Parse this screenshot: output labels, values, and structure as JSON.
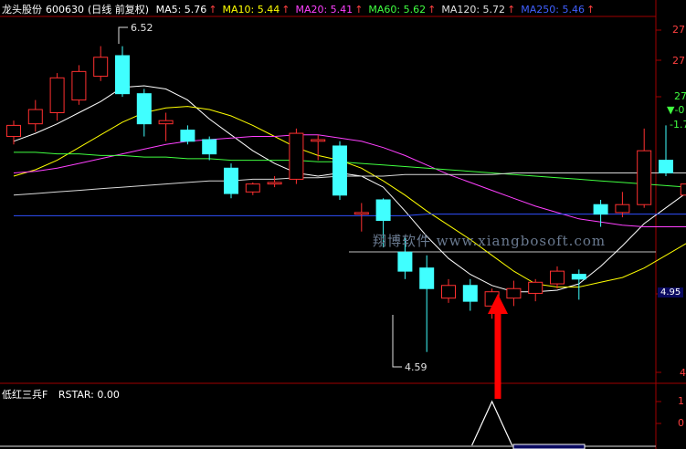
{
  "header": {
    "stock_name": "龙头股份",
    "stock_code": "600630",
    "period": "(日线 前复权)",
    "ma": [
      {
        "label": "MA5: 5.76",
        "color": "#ffffff"
      },
      {
        "label": "MA10: 5.44",
        "color": "#ffff00"
      },
      {
        "label": "MA20: 5.41",
        "color": "#ff40ff"
      },
      {
        "label": "MA60: 5.62",
        "color": "#40ff40"
      },
      {
        "label": "MA120: 5.72",
        "color": "#e0e0e0"
      },
      {
        "label": "MA250: 5.46",
        "color": "#4060ff"
      }
    ],
    "up_arrow": "↑"
  },
  "annotations": {
    "high_label": "6.52",
    "low_label": "4.59"
  },
  "right_axis": {
    "labels": [
      "27",
      "27",
      "27",
      "4.95",
      "4"
    ],
    "marker_down": "▼-0",
    "value_neg": "-1.7"
  },
  "indicator": {
    "name": "低红三兵F",
    "value": "RSTAR: 0.00",
    "axis_labels": [
      "1",
      "0"
    ]
  },
  "watermark": "翔博软件 www.xiangbosoft.com",
  "colors": {
    "background": "#000000",
    "up_candle": "#ff3030",
    "down_candle": "#40ffff",
    "arrow": "#ff0000",
    "axis": "#a00000"
  },
  "chart_data": {
    "type": "candlestick",
    "ylim": [
      4.45,
      6.65
    ],
    "candles": [
      {
        "o": 5.95,
        "c": 6.02,
        "h": 6.05,
        "l": 5.9
      },
      {
        "o": 6.03,
        "c": 6.12,
        "h": 6.18,
        "l": 5.98
      },
      {
        "o": 6.1,
        "c": 6.32,
        "h": 6.35,
        "l": 6.05
      },
      {
        "o": 6.18,
        "c": 6.36,
        "h": 6.4,
        "l": 6.15
      },
      {
        "o": 6.33,
        "c": 6.45,
        "h": 6.52,
        "l": 6.3
      },
      {
        "o": 6.46,
        "c": 6.22,
        "h": 6.52,
        "l": 6.2
      },
      {
        "o": 6.22,
        "c": 6.03,
        "h": 6.25,
        "l": 5.95
      },
      {
        "o": 6.03,
        "c": 6.05,
        "h": 6.1,
        "l": 5.92
      },
      {
        "o": 5.99,
        "c": 5.92,
        "h": 6.02,
        "l": 5.9
      },
      {
        "o": 5.93,
        "c": 5.84,
        "h": 5.95,
        "l": 5.8
      },
      {
        "o": 5.75,
        "c": 5.59,
        "h": 5.78,
        "l": 5.56
      },
      {
        "o": 5.6,
        "c": 5.65,
        "h": 5.66,
        "l": 5.58
      },
      {
        "o": 5.65,
        "c": 5.66,
        "h": 5.7,
        "l": 5.63
      },
      {
        "o": 5.68,
        "c": 5.97,
        "h": 6.0,
        "l": 5.65
      },
      {
        "o": 5.92,
        "c": 5.93,
        "h": 5.96,
        "l": 5.8
      },
      {
        "o": 5.89,
        "c": 5.58,
        "h": 5.92,
        "l": 5.55
      },
      {
        "o": 5.46,
        "c": 5.47,
        "h": 5.53,
        "l": 5.35
      },
      {
        "o": 5.55,
        "c": 5.42,
        "h": 5.56,
        "l": 5.25
      },
      {
        "o": 5.22,
        "c": 5.1,
        "h": 5.32,
        "l": 5.05
      },
      {
        "o": 5.12,
        "c": 4.99,
        "h": 5.2,
        "l": 4.59
      },
      {
        "o": 4.93,
        "c": 5.01,
        "h": 5.05,
        "l": 4.9
      },
      {
        "o": 5.01,
        "c": 4.91,
        "h": 5.05,
        "l": 4.85
      },
      {
        "o": 4.88,
        "c": 4.97,
        "h": 4.99,
        "l": 4.8
      },
      {
        "o": 4.93,
        "c": 4.99,
        "h": 5.04,
        "l": 4.88
      },
      {
        "o": 4.96,
        "c": 5.03,
        "h": 5.05,
        "l": 4.91
      },
      {
        "o": 5.02,
        "c": 5.1,
        "h": 5.13,
        "l": 4.99
      },
      {
        "o": 5.08,
        "c": 5.05,
        "h": 5.11,
        "l": 4.92
      },
      {
        "o": 5.52,
        "c": 5.46,
        "h": 5.55,
        "l": 5.38
      },
      {
        "o": 5.47,
        "c": 5.52,
        "h": 5.6,
        "l": 5.44
      },
      {
        "o": 5.52,
        "c": 5.86,
        "h": 6.0,
        "l": 5.5
      },
      {
        "o": 5.8,
        "c": 5.72,
        "h": 6.02,
        "l": 5.7
      },
      {
        "o": 5.58,
        "c": 5.65,
        "h": 5.73,
        "l": 5.45
      },
      {
        "o": 5.7,
        "c": 5.78,
        "h": 5.8,
        "l": 5.62
      },
      {
        "o": 5.76,
        "c": 6.0,
        "h": 6.12,
        "l": 5.72
      }
    ],
    "ma_lines": [
      {
        "name": "MA5",
        "color": "#ffffff",
        "values": [
          5.92,
          5.97,
          6.03,
          6.1,
          6.17,
          6.26,
          6.27,
          6.25,
          6.18,
          6.06,
          5.96,
          5.86,
          5.78,
          5.72,
          5.7,
          5.72,
          5.7,
          5.63,
          5.48,
          5.32,
          5.18,
          5.08,
          5.01,
          4.97,
          4.97,
          4.98,
          5.02,
          5.13,
          5.26,
          5.4,
          5.5,
          5.6,
          5.66,
          5.76
        ]
      },
      {
        "name": "MA10",
        "color": "#ffff00",
        "values": [
          5.7,
          5.74,
          5.8,
          5.88,
          5.96,
          6.04,
          6.1,
          6.13,
          6.14,
          6.12,
          6.08,
          6.02,
          5.95,
          5.88,
          5.83,
          5.8,
          5.75,
          5.67,
          5.58,
          5.48,
          5.39,
          5.3,
          5.2,
          5.1,
          5.02,
          5.0,
          5.0,
          5.03,
          5.06,
          5.12,
          5.2,
          5.28,
          5.36,
          5.44
        ]
      },
      {
        "name": "MA20",
        "color": "#ff40ff",
        "values": [
          5.72,
          5.73,
          5.75,
          5.78,
          5.81,
          5.84,
          5.87,
          5.9,
          5.92,
          5.93,
          5.94,
          5.95,
          5.95,
          5.96,
          5.96,
          5.94,
          5.92,
          5.88,
          5.83,
          5.77,
          5.71,
          5.66,
          5.61,
          5.56,
          5.51,
          5.47,
          5.43,
          5.41,
          5.39,
          5.38,
          5.38,
          5.38,
          5.39,
          5.41
        ]
      },
      {
        "name": "MA60",
        "color": "#40ff40",
        "values": [
          5.85,
          5.85,
          5.84,
          5.84,
          5.83,
          5.83,
          5.82,
          5.82,
          5.81,
          5.81,
          5.8,
          5.8,
          5.8,
          5.8,
          5.79,
          5.79,
          5.78,
          5.77,
          5.76,
          5.75,
          5.74,
          5.73,
          5.72,
          5.71,
          5.7,
          5.69,
          5.68,
          5.67,
          5.66,
          5.65,
          5.64,
          5.63,
          5.63,
          5.62
        ]
      },
      {
        "name": "MA120",
        "color": "#d8d8d8",
        "values": [
          5.58,
          5.59,
          5.6,
          5.61,
          5.62,
          5.63,
          5.64,
          5.65,
          5.66,
          5.67,
          5.67,
          5.68,
          5.68,
          5.69,
          5.69,
          5.7,
          5.7,
          5.7,
          5.71,
          5.71,
          5.71,
          5.71,
          5.71,
          5.72,
          5.72,
          5.72,
          5.72,
          5.72,
          5.72,
          5.72,
          5.72,
          5.72,
          5.72,
          5.72
        ]
      },
      {
        "name": "MA250",
        "color": "#3050ff",
        "values": [
          5.45,
          5.45,
          5.45,
          5.45,
          5.45,
          5.45,
          5.45,
          5.45,
          5.45,
          5.45,
          5.45,
          5.45,
          5.45,
          5.45,
          5.45,
          5.45,
          5.45,
          5.45,
          5.45,
          5.46,
          5.46,
          5.46,
          5.46,
          5.46,
          5.46,
          5.46,
          5.46,
          5.46,
          5.46,
          5.46,
          5.46,
          5.46,
          5.46,
          5.46
        ]
      }
    ],
    "indicator_signal_index": 22
  }
}
